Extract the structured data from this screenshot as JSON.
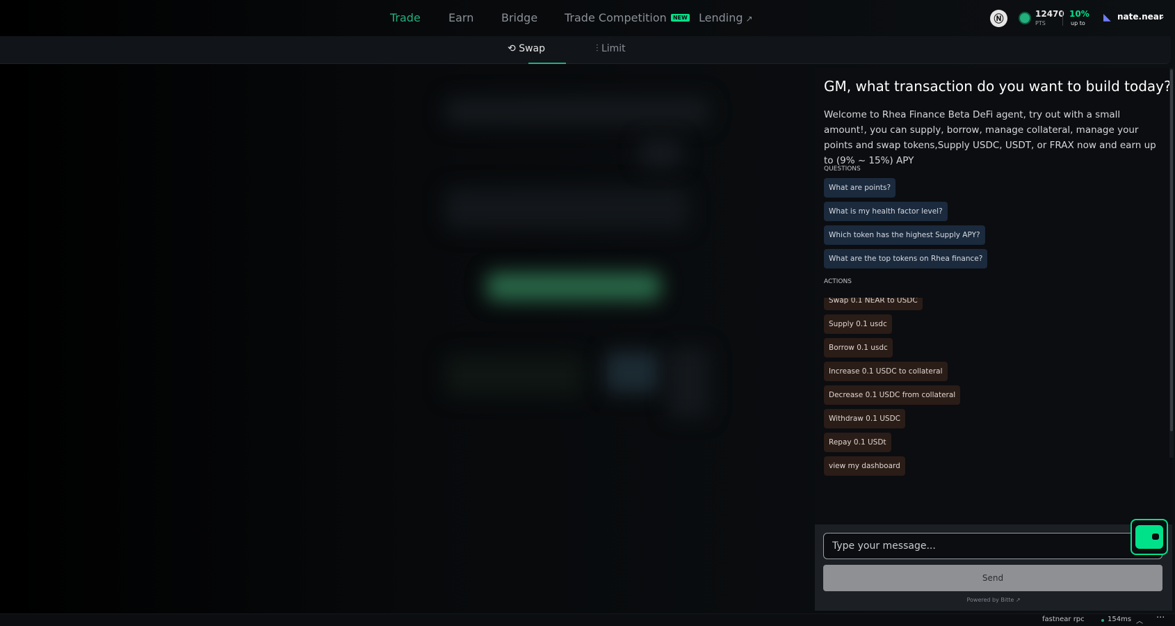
{
  "nav": {
    "items": [
      {
        "label": "Trade"
      },
      {
        "label": "Earn"
      },
      {
        "label": "Bridge"
      },
      {
        "label": "Trade Competition",
        "badge": "NEW"
      },
      {
        "label": "Lending",
        "external_icon": "↗"
      }
    ],
    "points": {
      "value": "12470",
      "label": "PTS"
    },
    "boost": {
      "value": "10%",
      "label": "up to"
    },
    "user": {
      "name": "nate.near"
    }
  },
  "subtabs": [
    {
      "label": "Swap",
      "icon": "swap-icon"
    },
    {
      "label": "Limit",
      "icon": "chart-icon"
    }
  ],
  "chat": {
    "title": "GM, what transaction do you want to build today?",
    "intro": "Welcome to Rhea Finance Beta DeFi agent, try out with a small amount!, you can supply, borrow, manage collateral, manage your points and swap tokens,Supply USDC, USDT, or FRAX now and earn up to (9% ~ 15%) APY",
    "questions_label": "QUESTIONS",
    "questions": [
      "What are points?",
      "What is my health factor level?",
      "Which token has the highest Supply APY?",
      "What are the top tokens on Rhea finance?"
    ],
    "actions_label": "ACTIONS",
    "actions": [
      "Swap 0.1 NEAR to USDC",
      "Supply 0.1 usdc",
      "Borrow 0.1 usdc",
      "Increase 0.1 USDC to collateral",
      "Decrease 0.1 USDC from collateral",
      "Withdraw 0.1 USDC",
      "Repay 0.1 USDt",
      "view my dashboard"
    ],
    "input_placeholder": "Type your message...",
    "send_label": "Send",
    "powered_by": "Powered by Bitte ↗"
  },
  "status": {
    "rpc": "fastnear rpc",
    "latency": "154ms"
  },
  "colors": {
    "accent": "#22b07d",
    "neon": "#00e28a",
    "question_chip": "#1b2a3d",
    "action_chip": "#2a1c17"
  }
}
